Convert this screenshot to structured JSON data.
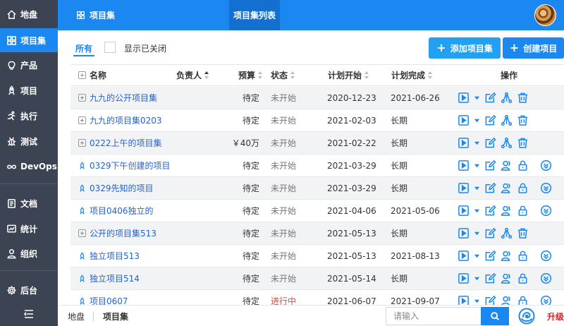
{
  "sidebar": {
    "items": [
      {
        "label": "地盘",
        "icon": "home-icon"
      },
      {
        "label": "项目集",
        "icon": "grid-icon"
      },
      {
        "label": "产品",
        "icon": "bulb-icon"
      },
      {
        "label": "项目",
        "icon": "rocket-icon"
      },
      {
        "label": "执行",
        "icon": "run-icon"
      },
      {
        "label": "测试",
        "icon": "bug-icon"
      },
      {
        "label": "DevOps",
        "icon": "infinity-icon"
      },
      {
        "label": "文档",
        "icon": "doc-icon"
      },
      {
        "label": "统计",
        "icon": "chart-icon"
      },
      {
        "label": "组织",
        "icon": "user-icon"
      },
      {
        "label": "后台",
        "icon": "gear-icon"
      }
    ],
    "active_index": 1
  },
  "topbar": {
    "title": "项目集",
    "tab": "项目集列表"
  },
  "filter": {
    "all_label": "所有",
    "show_closed_label": "显示已关闭"
  },
  "actions": {
    "add_label": "添加项目集",
    "create_label": "创建项目"
  },
  "table": {
    "headers": {
      "name": "名称",
      "owner": "负责人",
      "budget": "预算",
      "status": "状态",
      "begin": "计划开始",
      "end": "计划完成",
      "ops": "操作"
    },
    "rows": [
      {
        "kind": "program",
        "name": "九九的公开项目集",
        "budget": "待定",
        "status": "未开始",
        "begin": "2020-12-23",
        "end": "2021-06-26"
      },
      {
        "kind": "program",
        "name": "九九的项目集0203",
        "budget": "待定",
        "status": "未开始",
        "begin": "2021-02-03",
        "end": "长期"
      },
      {
        "kind": "program",
        "name": "0222上午的项目集",
        "budget": "￥40万",
        "status": "未开始",
        "begin": "2021-02-22",
        "end": "长期"
      },
      {
        "kind": "project",
        "name": "0329下午创建的项目",
        "budget": "待定",
        "status": "未开始",
        "begin": "2021-03-29",
        "end": "长期"
      },
      {
        "kind": "project",
        "name": "0329先知的项目",
        "budget": "待定",
        "status": "未开始",
        "begin": "2021-03-29",
        "end": "长期"
      },
      {
        "kind": "project",
        "name": "项目0406独立的",
        "budget": "待定",
        "status": "未开始",
        "begin": "2021-04-06",
        "end": "2021-05-06"
      },
      {
        "kind": "program",
        "name": "公开的项目集513",
        "budget": "待定",
        "status": "未开始",
        "begin": "2021-05-13",
        "end": "长期"
      },
      {
        "kind": "project",
        "name": "独立项目513",
        "budget": "待定",
        "status": "未开始",
        "begin": "2021-05-13",
        "end": "2021-08-13"
      },
      {
        "kind": "project",
        "name": "独立项目514",
        "budget": "待定",
        "status": "未开始",
        "begin": "2021-05-14",
        "end": "长期"
      },
      {
        "kind": "project",
        "name": "项目0607",
        "budget": "待定",
        "status": "进行中",
        "begin": "2021-06-07",
        "end": "2021-09-07"
      }
    ]
  },
  "footer": {
    "crumb_home": "地盘",
    "crumb_current": "项目集",
    "search_placeholder": "请输入",
    "upgrade_label": "升级"
  },
  "colors": {
    "accent": "#1b87f0",
    "sidebar_bg": "#3c4352",
    "status_active": "#e24a3b",
    "upgrade": "#e02020"
  }
}
